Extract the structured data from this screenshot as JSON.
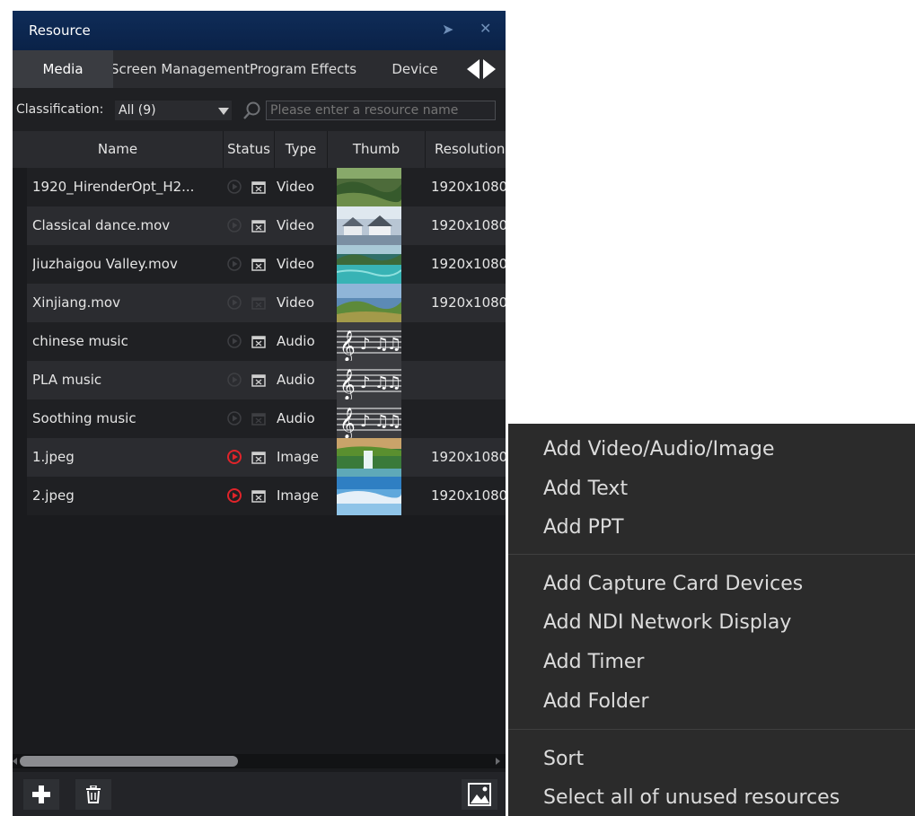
{
  "panel": {
    "title": "Resource",
    "pin_icon": "pin-icon",
    "close_icon": "close-icon"
  },
  "tabs": [
    {
      "label": "Media",
      "active": true
    },
    {
      "label": "Screen Management",
      "active": false
    },
    {
      "label": "Program Effects",
      "active": false
    },
    {
      "label": "Device",
      "active": false
    }
  ],
  "filter": {
    "label": "Classification:",
    "selected": "All  (9)",
    "placeholder": "Please enter a resource name"
  },
  "table": {
    "columns": [
      "Name",
      "Status",
      "Type",
      "Thumb",
      "Resolution"
    ],
    "rows": [
      {
        "name": "1920_HirenderOpt_H2...",
        "status": "unused",
        "locked": true,
        "type": "Video",
        "thumb": "landscape-green",
        "resolution": "1920x1080"
      },
      {
        "name": "Classical dance.mov",
        "status": "unused",
        "locked": true,
        "type": "Video",
        "thumb": "landscape-village",
        "resolution": "1920x1080"
      },
      {
        "name": "Jiuzhaigou Valley.mov",
        "status": "unused",
        "locked": true,
        "type": "Video",
        "thumb": "landscape-lake",
        "resolution": "1920x1080"
      },
      {
        "name": "Xinjiang.mov",
        "status": "unused",
        "locked": false,
        "type": "Video",
        "thumb": "landscape-hills",
        "resolution": "1920x1080"
      },
      {
        "name": "chinese music",
        "status": "unused",
        "locked": true,
        "type": "Audio",
        "thumb": "music-notes",
        "resolution": ""
      },
      {
        "name": "PLA music",
        "status": "unused",
        "locked": true,
        "type": "Audio",
        "thumb": "music-notes",
        "resolution": ""
      },
      {
        "name": "Soothing music",
        "status": "unused",
        "locked": false,
        "type": "Audio",
        "thumb": "music-notes",
        "resolution": ""
      },
      {
        "name": "1.jpeg",
        "status": "in-use",
        "locked": true,
        "type": "Image",
        "thumb": "landscape-waterfall",
        "resolution": "1920x1080"
      },
      {
        "name": "2.jpeg",
        "status": "in-use",
        "locked": true,
        "type": "Image",
        "thumb": "landscape-snow",
        "resolution": "1920x1080"
      }
    ]
  },
  "toolbar": {
    "add_icon": "plus-icon",
    "delete_icon": "trash-icon",
    "thumb_view_icon": "image-icon"
  },
  "context_menu": {
    "groups": [
      [
        "Add Video/Audio/Image",
        "Add Text",
        "Add PPT"
      ],
      [
        "Add Capture Card Devices",
        "Add NDI Network Display",
        "Add Timer",
        "Add Folder"
      ],
      [
        "Sort",
        "Select all of unused resources"
      ]
    ]
  },
  "colors": {
    "title_bg": "#0a2248",
    "panel_bg": "#1a1b1e",
    "in_use_status": "#e0242a",
    "menu_bg": "#2b2b2b"
  }
}
